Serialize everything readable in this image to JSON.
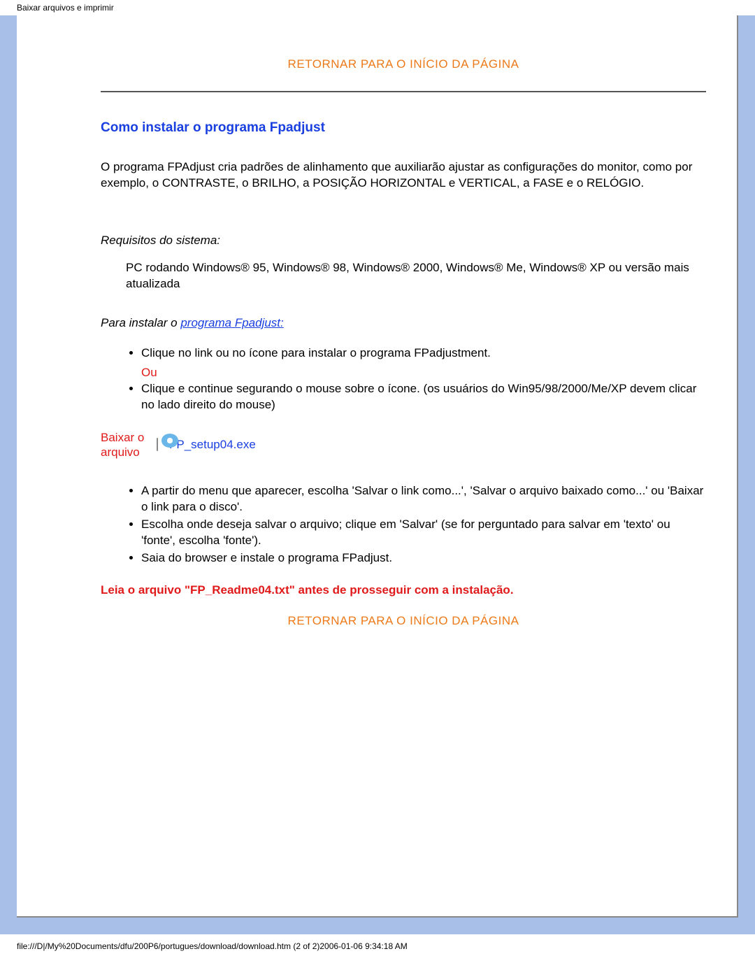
{
  "browser_title": "Baixar arquivos e imprimir",
  "top_link": "RETORNAR PARA O INÍCIO DA PÁGINA",
  "heading": "Como instalar o programa Fpadjust",
  "intro_paragraph": "O programa FPAdjust cria padrões de alinhamento que auxiliarão ajustar as configurações do monitor, como por exemplo, o CONTRASTE, o BRILHO, a POSIÇÃO HORIZONTAL e VERTICAL, a FASE e o RELÓGIO.",
  "requirements_label": "Requisitos do sistema:",
  "requirements_text": "PC rodando Windows® 95, Windows® 98, Windows® 2000, Windows® Me, Windows® XP ou versão mais atualizada",
  "install_label_prefix": "Para instalar o ",
  "install_label_link": "programa Fpadjust:",
  "bullets_a": [
    "Clique no link ou no ícone para instalar o programa FPadjustment."
  ],
  "ou_label": "Ou",
  "bullets_a2": [
    "Clique e continue segurando o mouse sobre o ícone. (os usuários do Win95/98/2000/Me/XP devem clicar no lado direito do mouse)"
  ],
  "download_label": "Baixar o arquivo",
  "download_filename": "FP_setup04.exe",
  "bullets_b": [
    "A partir do menu que aparecer, escolha 'Salvar o link como...', 'Salvar o arquivo baixado como...' ou 'Baixar o link para o disco'.",
    "Escolha onde deseja salvar o arquivo; clique em 'Salvar' (se for perguntado para salvar em 'texto' ou 'fonte', escolha 'fonte').",
    "Saia do browser e instale o programa FPadjust."
  ],
  "warning_text": "Leia o arquivo \"FP_Readme04.txt\" antes de prosseguir com a instalação.",
  "bottom_link": "RETORNAR PARA O INÍCIO DA PÁGINA",
  "footer_path": "file:///D|/My%20Documents/dfu/200P6/portugues/download/download.htm (2 of 2)2006-01-06 9:34:18 AM"
}
